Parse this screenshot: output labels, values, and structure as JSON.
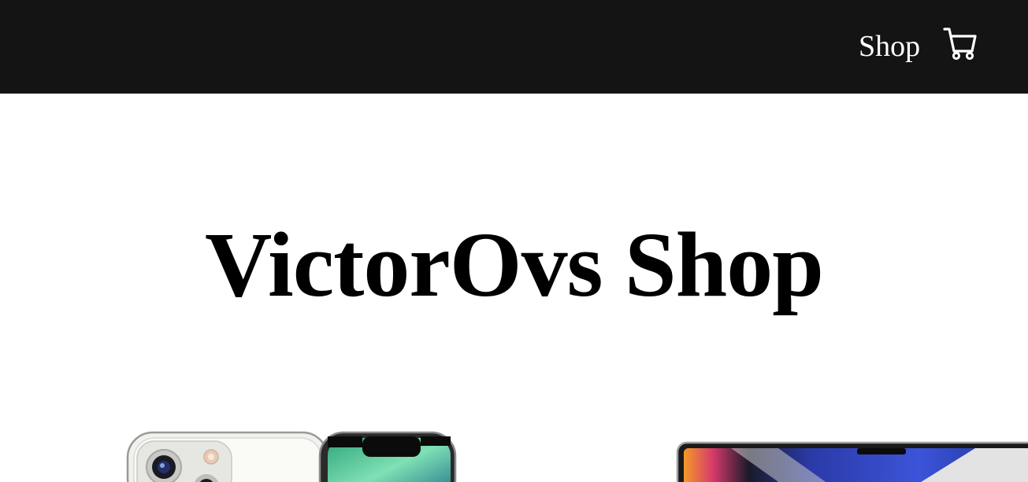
{
  "navbar": {
    "shop_link": "Shop",
    "cart_icon": "cart-icon"
  },
  "hero": {
    "title": "VictorOvs Shop"
  },
  "products": [
    {
      "image": "iphone-13-pro-image"
    },
    {
      "image": "macbook-pro-image"
    }
  ],
  "colors": {
    "navbar_bg": "#141414",
    "nav_text": "#ffffff",
    "page_bg": "#ffffff",
    "title_text": "#000000"
  }
}
